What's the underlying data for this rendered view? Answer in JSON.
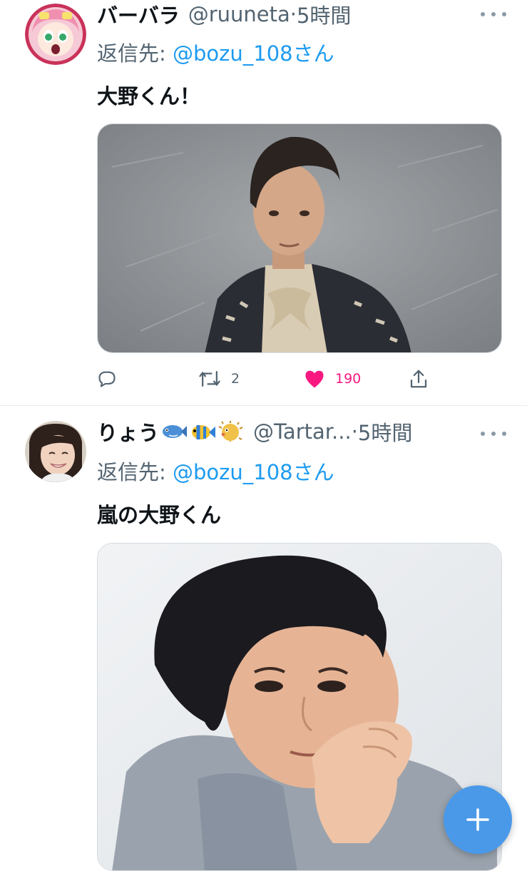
{
  "tweets": [
    {
      "display_name": "バーバラ",
      "handle": "@ruuneta",
      "separator": "·",
      "time": "5時間",
      "reply_prefix": "返信先: ",
      "reply_to": "@bozu_108さん",
      "text": "大野くん！",
      "retweets": "2",
      "likes": "190"
    },
    {
      "display_name": "りょう",
      "name_emojis": [
        "blue-fish",
        "tropical-fish",
        "blowfish"
      ],
      "handle": "@Tartar...",
      "separator": "·",
      "time": "5時間",
      "reply_prefix": "返信先: ",
      "reply_to": "@bozu_108さん",
      "text": "嵐の大野くん"
    }
  ],
  "colors": {
    "accent": "#1d9bf0",
    "like": "#f91880",
    "fab": "#4a99e9"
  },
  "icons": [
    "reply-icon",
    "retweet-icon",
    "like-icon",
    "share-icon",
    "more-icon",
    "compose-plus-icon"
  ]
}
